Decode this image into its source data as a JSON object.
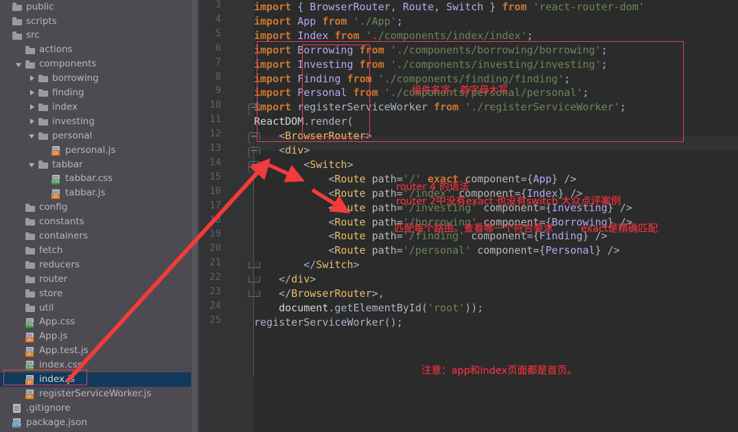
{
  "sidebar": {
    "name": "project-file-tree",
    "items": [
      {
        "label": "public",
        "indent": 1,
        "twisty": "none",
        "icon": "folder",
        "selected": false
      },
      {
        "label": "scripts",
        "indent": 1,
        "twisty": "none",
        "icon": "folder",
        "selected": false
      },
      {
        "label": "src",
        "indent": 1,
        "twisty": "none",
        "icon": "folder",
        "selected": false
      },
      {
        "label": "actions",
        "indent": 2,
        "twisty": "none",
        "icon": "folder",
        "selected": false
      },
      {
        "label": "components",
        "indent": 2,
        "twisty": "down",
        "icon": "folder",
        "selected": false
      },
      {
        "label": "borrowing",
        "indent": 3,
        "twisty": "right",
        "icon": "folder",
        "selected": false
      },
      {
        "label": "finding",
        "indent": 3,
        "twisty": "right",
        "icon": "folder",
        "selected": false
      },
      {
        "label": "index",
        "indent": 3,
        "twisty": "right",
        "icon": "folder",
        "selected": false
      },
      {
        "label": "investing",
        "indent": 3,
        "twisty": "right",
        "icon": "folder",
        "selected": false
      },
      {
        "label": "personal",
        "indent": 3,
        "twisty": "down",
        "icon": "folder",
        "selected": false
      },
      {
        "label": "personal.js",
        "indent": 4,
        "twisty": "none",
        "icon": "js-file",
        "selected": false
      },
      {
        "label": "tabbar",
        "indent": 3,
        "twisty": "down",
        "icon": "folder",
        "selected": false
      },
      {
        "label": "tabbar.css",
        "indent": 4,
        "twisty": "none",
        "icon": "css-file",
        "selected": false
      },
      {
        "label": "tabbar.js",
        "indent": 4,
        "twisty": "none",
        "icon": "js-file",
        "selected": false
      },
      {
        "label": "config",
        "indent": 2,
        "twisty": "none",
        "icon": "folder",
        "selected": false
      },
      {
        "label": "constants",
        "indent": 2,
        "twisty": "none",
        "icon": "folder",
        "selected": false
      },
      {
        "label": "containers",
        "indent": 2,
        "twisty": "none",
        "icon": "folder",
        "selected": false
      },
      {
        "label": "fetch",
        "indent": 2,
        "twisty": "none",
        "icon": "folder",
        "selected": false
      },
      {
        "label": "reducers",
        "indent": 2,
        "twisty": "none",
        "icon": "folder",
        "selected": false
      },
      {
        "label": "router",
        "indent": 2,
        "twisty": "none",
        "icon": "folder",
        "selected": false
      },
      {
        "label": "store",
        "indent": 2,
        "twisty": "none",
        "icon": "folder",
        "selected": false
      },
      {
        "label": "util",
        "indent": 2,
        "twisty": "none",
        "icon": "folder",
        "selected": false
      },
      {
        "label": "App.css",
        "indent": 2,
        "twisty": "none",
        "icon": "css-file",
        "selected": false
      },
      {
        "label": "App.js",
        "indent": 2,
        "twisty": "none",
        "icon": "js-file",
        "selected": false
      },
      {
        "label": "App.test.js",
        "indent": 2,
        "twisty": "none",
        "icon": "test-file",
        "selected": false
      },
      {
        "label": "index.css",
        "indent": 2,
        "twisty": "none",
        "icon": "css-file",
        "selected": false
      },
      {
        "label": "index.js",
        "indent": 2,
        "twisty": "none",
        "icon": "js-file",
        "selected": true
      },
      {
        "label": "registerServiceWorker.js",
        "indent": 2,
        "twisty": "none",
        "icon": "js-file",
        "selected": false
      },
      {
        "label": ".gitignore",
        "indent": 1,
        "twisty": "none",
        "icon": "doc-file",
        "selected": false
      },
      {
        "label": "package.json",
        "indent": 1,
        "twisty": "none",
        "icon": "json-file",
        "selected": false
      }
    ]
  },
  "editor": {
    "file": "index.js",
    "first_line_number": 3,
    "cursor_line": 10,
    "line_numbers": [
      3,
      4,
      5,
      6,
      7,
      8,
      9,
      10,
      11,
      12,
      13,
      14,
      15,
      16,
      17,
      18,
      19,
      20,
      21,
      22,
      23,
      24,
      25
    ],
    "lines": [
      {
        "n": 3,
        "text": "import { BrowserRouter, Route, Switch } from 'react-router-dom'"
      },
      {
        "n": 4,
        "text": "import App from './App';"
      },
      {
        "n": 5,
        "text": "import Index from './components/index/index';"
      },
      {
        "n": 6,
        "text": "import Borrowing from './components/borrowing/borrowing';"
      },
      {
        "n": 7,
        "text": "import Investing from './components/investing/investing';"
      },
      {
        "n": 8,
        "text": "import Finding from './components/finding/finding';"
      },
      {
        "n": 9,
        "text": "import Personal from './components/personal/personal';"
      },
      {
        "n": 10,
        "text": "import registerServiceWorker from './registerServiceWorker';"
      },
      {
        "n": 11,
        "text": "ReactDOM.render("
      },
      {
        "n": 12,
        "text": "    <BrowserRouter>"
      },
      {
        "n": 13,
        "text": "    <div>"
      },
      {
        "n": 14,
        "text": "        <Switch>"
      },
      {
        "n": 15,
        "text": "            <Route path='/' exact component={App} />"
      },
      {
        "n": 16,
        "text": "            <Route path='/index' component={Index} />"
      },
      {
        "n": 17,
        "text": "            <Route path='/investing' component={Investing} />"
      },
      {
        "n": 18,
        "text": "            <Route path='/borrowing' component={Borrowing} />"
      },
      {
        "n": 19,
        "text": "            <Route path='/finding' component={Finding} />"
      },
      {
        "n": 20,
        "text": "            <Route path='/personal' component={Personal} />"
      },
      {
        "n": 21,
        "text": "        </Switch>"
      },
      {
        "n": 22,
        "text": "    </div>"
      },
      {
        "n": 23,
        "text": "    </BrowserRouter>,"
      },
      {
        "n": 24,
        "text": "    document.getElementById('root'));"
      },
      {
        "n": 25,
        "text": "registerServiceWorker();"
      }
    ]
  },
  "annotations": {
    "note_components": "组件名字。首字母大写",
    "note_router4_line1": "router 4 的语法",
    "note_router4_line2": "router 2中没有exact 也没有switch  大众点评案例",
    "note_match": "匹配每个路由。查看哪一个符合要求",
    "note_exact": "exact是精确匹配",
    "note_home": "注意：app和index页面都是首页。"
  },
  "colors": {
    "annotation_red": "#f0333f",
    "box_red": "#e8415f",
    "arrow_red": "#f23b3b",
    "editor_bg": "#2b2b2b",
    "gutter_bg": "#313335",
    "sidebar_bg": "#4e4a52",
    "selection_blue": "#113a5c",
    "keyword_orange": "#cc7832",
    "string_green": "#6a8759",
    "tag_yellow": "#e8bf6a",
    "class_purple": "#b9a8f0"
  }
}
